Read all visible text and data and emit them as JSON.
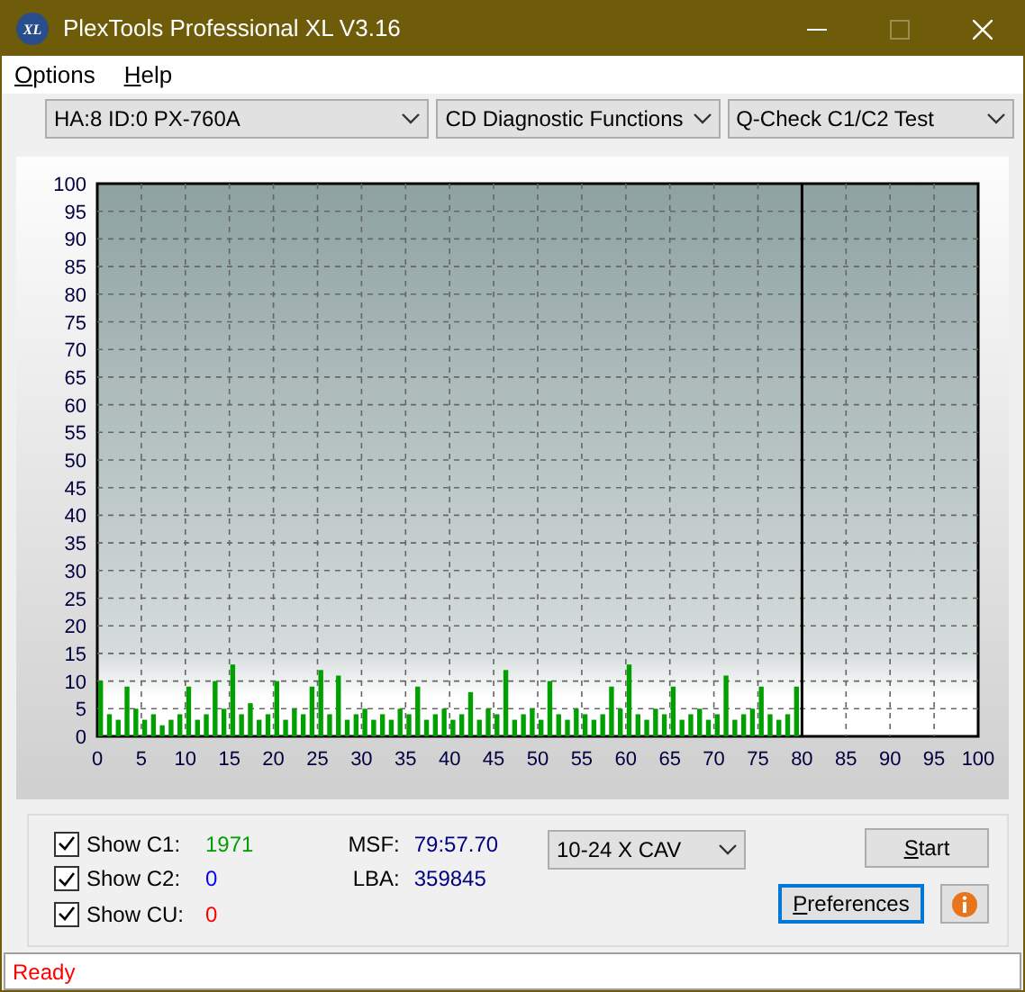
{
  "window": {
    "logo_text": "XL",
    "title": "PlexTools Professional XL V3.16",
    "maximize_disabled": true
  },
  "menu": [
    {
      "label": "Options"
    },
    {
      "label": "Help"
    }
  ],
  "toolbar": {
    "dropdowns": [
      {
        "value": "HA:8 ID:0  PX-760A"
      },
      {
        "value": "CD Diagnostic Functions"
      },
      {
        "value": "Q-Check C1/C2 Test"
      }
    ]
  },
  "chart": {
    "chart_data": {
      "type": "bar",
      "grid": true,
      "xlim": [
        0,
        100
      ],
      "ylim": [
        0,
        100
      ],
      "xticks": [
        0,
        5,
        10,
        15,
        20,
        25,
        30,
        35,
        40,
        45,
        50,
        55,
        60,
        65,
        70,
        75,
        80,
        85,
        90,
        95,
        100
      ],
      "yticks": [
        0,
        5,
        10,
        15,
        20,
        25,
        30,
        35,
        40,
        45,
        50,
        55,
        60,
        65,
        70,
        75,
        80,
        85,
        90,
        95,
        100
      ],
      "x": [
        0,
        1,
        2,
        3,
        4,
        5,
        6,
        7,
        8,
        9,
        10,
        11,
        12,
        13,
        14,
        15,
        16,
        17,
        18,
        19,
        20,
        21,
        22,
        23,
        24,
        25,
        26,
        27,
        28,
        29,
        30,
        31,
        32,
        33,
        34,
        35,
        36,
        37,
        38,
        39,
        40,
        41,
        42,
        43,
        44,
        45,
        46,
        47,
        48,
        49,
        50,
        51,
        52,
        53,
        54,
        55,
        56,
        57,
        58,
        59,
        60,
        61,
        62,
        63,
        64,
        65,
        66,
        67,
        68,
        69,
        70,
        71,
        72,
        73,
        74,
        75,
        76,
        77,
        78,
        79
      ],
      "series": [
        {
          "color": "#00a000",
          "values": [
            10,
            4,
            3,
            9,
            5,
            3,
            4,
            2,
            3,
            4,
            9,
            3,
            4,
            10,
            5,
            13,
            4,
            6,
            3,
            4,
            10,
            3,
            5,
            4,
            9,
            12,
            4,
            11,
            3,
            4,
            5,
            3,
            4,
            3,
            5,
            4,
            9,
            3,
            4,
            5,
            3,
            4,
            8,
            3,
            5,
            4,
            12,
            3,
            4,
            5,
            3,
            10,
            4,
            3,
            5,
            4,
            3,
            4,
            9,
            5,
            13,
            4,
            3,
            5,
            4,
            9,
            3,
            4,
            5,
            3,
            4,
            11,
            3,
            4,
            5,
            9,
            4,
            3,
            4,
            9
          ]
        }
      ],
      "ref_lines": [
        {
          "axis": "x",
          "value": 80,
          "color": "#000000"
        }
      ]
    }
  },
  "bottom_panel": {
    "counters": [
      {
        "label": "Show C1:",
        "checked": true,
        "value": "1971",
        "color": "#00a000"
      },
      {
        "label": "Show C2:",
        "checked": true,
        "value": "0",
        "color": "#0000ff"
      },
      {
        "label": "Show CU:",
        "checked": true,
        "value": "0",
        "color": "#ff0000"
      }
    ],
    "readouts": [
      {
        "label": "MSF:",
        "value": "79:57.70"
      },
      {
        "label": "LBA:",
        "value": "359845"
      }
    ],
    "speed": {
      "value": "10-24 X CAV"
    },
    "start_button": {
      "label": "Start",
      "focused": false
    },
    "preferences_button": {
      "label": "Preferences",
      "focused": true
    }
  },
  "status_bar": {
    "text": "Ready"
  }
}
